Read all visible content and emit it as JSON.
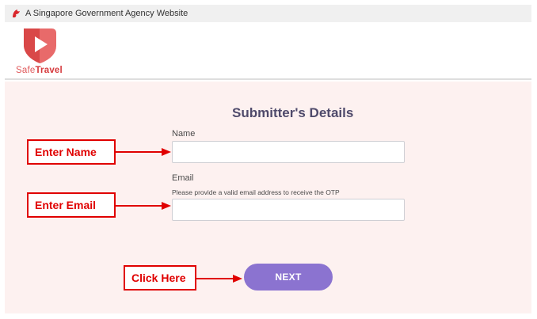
{
  "gov_bar": {
    "text": "A Singapore Government Agency Website",
    "icon": "singapore-lion-icon"
  },
  "logo": {
    "icon": "safetravel-play-shield-icon",
    "text_safe": "Safe",
    "text_travel": "Travel",
    "brand_color": "#d63a3d"
  },
  "form": {
    "title": "Submitter's Details",
    "name_label": "Name",
    "name_value": "",
    "email_label": "Email",
    "email_hint": "Please provide a valid email address to receive the OTP",
    "email_value": "",
    "next_label": "NEXT",
    "next_color": "#8b73d0",
    "background_color": "#fdf1f0"
  },
  "annotations": {
    "enter_name": "Enter Name",
    "enter_email": "Enter Email",
    "click_here": "Click Here",
    "color": "#e00000"
  }
}
